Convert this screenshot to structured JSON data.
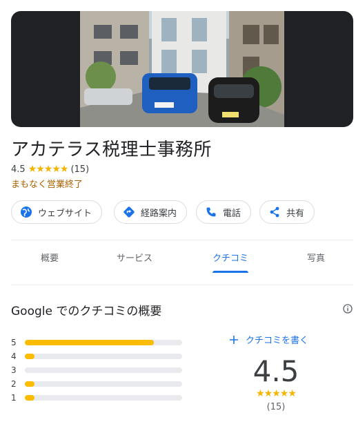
{
  "place": {
    "name": "アカテラス税理士事務所",
    "rating": "4.5",
    "stars": "★★★★★",
    "review_count": "(15)",
    "status": "まもなく営業終了"
  },
  "actions": [
    {
      "label": "ウェブサイト",
      "icon": "globe-icon"
    },
    {
      "label": "経路案内",
      "icon": "directions-icon"
    },
    {
      "label": "電話",
      "icon": "phone-icon"
    },
    {
      "label": "共有",
      "icon": "share-icon"
    }
  ],
  "tabs": [
    {
      "label": "概要"
    },
    {
      "label": "サービス"
    },
    {
      "label": "クチコミ",
      "active": true
    },
    {
      "label": "写真"
    }
  ],
  "reviews": {
    "title": "Google でのクチコミの概要",
    "write_label": "クチコミを書く",
    "average": "4.5",
    "stars": "★★★★★",
    "count": "(15)",
    "distribution": [
      {
        "star": "5",
        "fraction": 0.82
      },
      {
        "star": "4",
        "fraction": 0.06
      },
      {
        "star": "3",
        "fraction": 0.0
      },
      {
        "star": "2",
        "fraction": 0.06
      },
      {
        "star": "1",
        "fraction": 0.06
      }
    ]
  },
  "colors": {
    "accent": "#1a73e8",
    "star": "#fbbc04",
    "status": "#b06000"
  }
}
